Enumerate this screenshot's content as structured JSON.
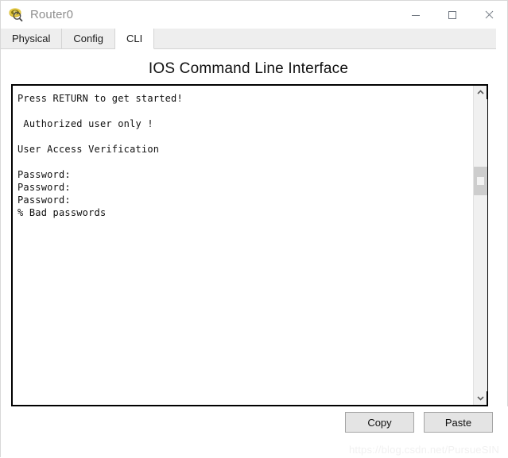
{
  "window": {
    "title": "Router0",
    "icon": "packet-tracer-device-icon",
    "controls": {
      "minimize": "minimize-icon",
      "maximize": "maximize-icon",
      "close": "close-icon"
    }
  },
  "tabs": [
    {
      "label": "Physical",
      "active": false
    },
    {
      "label": "Config",
      "active": false
    },
    {
      "label": "CLI",
      "active": true
    }
  ],
  "heading": "IOS Command Line Interface",
  "terminal": {
    "lines": [
      "Press RETURN to get started!",
      "",
      " Authorized user only !",
      "",
      "User Access Verification",
      "",
      "Password:",
      "Password:",
      "Password:",
      "% Bad passwords"
    ],
    "text": "Press RETURN to get started!\n\n Authorized user only !\n\nUser Access Verification\n\nPassword:\nPassword:\nPassword:\n% Bad passwords",
    "scrollbar": {
      "up_arrow": "chevron-up-icon",
      "down_arrow": "chevron-down-icon",
      "thumb_top_percent": 23,
      "thumb_height_percent": 10
    }
  },
  "footer": {
    "copy_label": "Copy",
    "paste_label": "Paste",
    "watermark": "https://blog.csdn.net/PursueSIN"
  },
  "colors": {
    "tabstrip_bg": "#eeeeee",
    "active_tab_bg": "#ffffff",
    "terminal_border": "#000000",
    "button_bg": "#e4e4e4",
    "title_text": "#8e8e8e",
    "scroll_thumb": "#cdcdcd"
  }
}
